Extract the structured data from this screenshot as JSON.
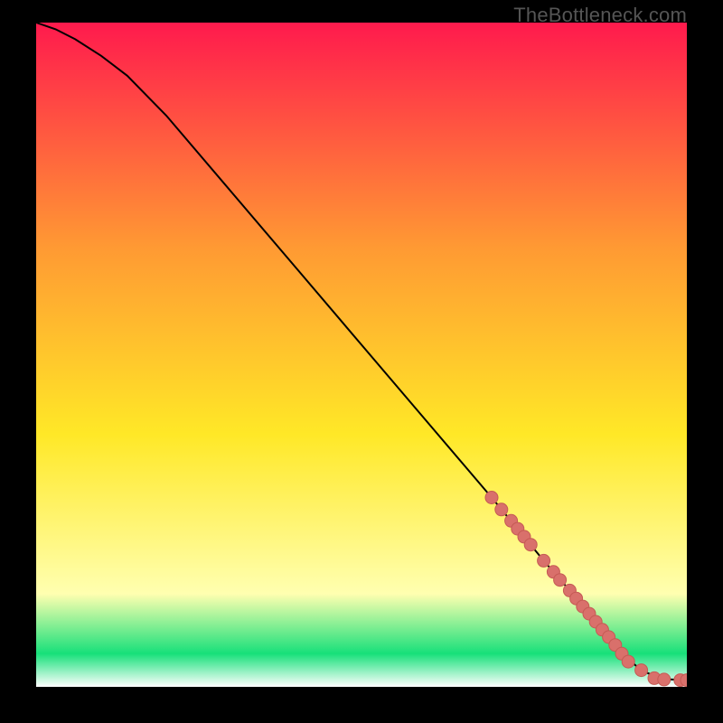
{
  "watermark": "TheBottleneck.com",
  "colors": {
    "frame": "#000000",
    "curve": "#000000",
    "point_fill": "#d9706b",
    "point_stroke": "#c55a54",
    "grad_top": "#ff1a4d",
    "grad_mid1": "#ff9a33",
    "grad_mid2": "#ffe827",
    "grad_mid3": "#ffffb0",
    "grad_green": "#17e07a",
    "grad_bottom": "#ffffff"
  },
  "chart_data": {
    "type": "line",
    "title": "",
    "xlabel": "",
    "ylabel": "",
    "xlim": [
      0,
      100
    ],
    "ylim": [
      0,
      100
    ],
    "curve": {
      "x": [
        0,
        3,
        6,
        10,
        14,
        20,
        30,
        40,
        50,
        60,
        70,
        78,
        82,
        85,
        88,
        90,
        93,
        96,
        100
      ],
      "y": [
        100,
        99,
        97.5,
        95,
        92,
        86,
        74.5,
        63,
        51.5,
        40,
        28.5,
        19,
        14.5,
        11,
        7.5,
        5,
        2.5,
        1.2,
        1.0
      ]
    },
    "series": [
      {
        "name": "points",
        "x": [
          70,
          71.5,
          73,
          74,
          75,
          76,
          78,
          79.5,
          80.5,
          82,
          83,
          84,
          85,
          86,
          87,
          88,
          89,
          90,
          91,
          93,
          95,
          96.5,
          99,
          100
        ],
        "y": [
          28.5,
          26.7,
          25,
          23.8,
          22.6,
          21.4,
          19,
          17.3,
          16.1,
          14.5,
          13.3,
          12.1,
          11,
          9.8,
          8.6,
          7.5,
          6.3,
          5,
          3.8,
          2.5,
          1.3,
          1.1,
          1.0,
          1.0
        ]
      }
    ]
  }
}
